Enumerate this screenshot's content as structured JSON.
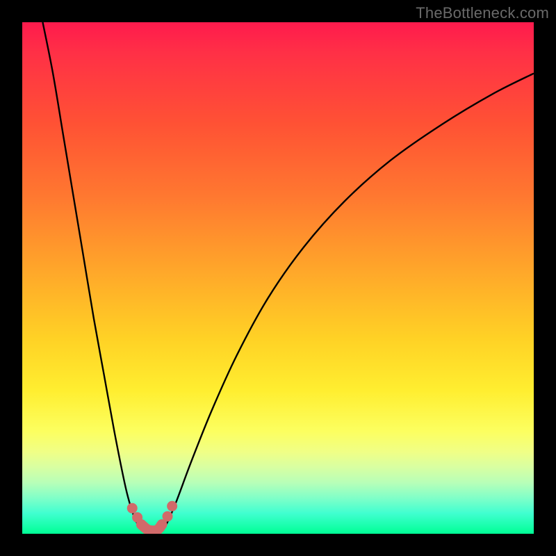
{
  "watermark": "TheBottleneck.com",
  "colors": {
    "frame_bg_top": "#ff1a4d",
    "frame_bg_bottom": "#00ff95",
    "curve_stroke": "#000000",
    "marker": "#d16a6a",
    "page_bg": "#000000",
    "watermark_text": "#6a6a6a"
  },
  "chart_data": {
    "type": "line",
    "title": "",
    "xlabel": "",
    "ylabel": "",
    "xlim": [
      0,
      100
    ],
    "ylim": [
      0,
      100
    ],
    "series": [
      {
        "name": "left-branch",
        "x": [
          4,
          6,
          8,
          10,
          12,
          14,
          16,
          18,
          20,
          21,
          22,
          23,
          24
        ],
        "y": [
          100,
          90,
          78,
          66,
          54,
          42,
          31,
          20,
          10,
          6,
          3,
          1.2,
          0.5
        ]
      },
      {
        "name": "right-branch",
        "x": [
          27,
          28,
          30,
          33,
          37,
          42,
          48,
          55,
          63,
          72,
          82,
          92,
          100
        ],
        "y": [
          0.5,
          1.5,
          6,
          14,
          24,
          35,
          46,
          56,
          65,
          73,
          80,
          86,
          90
        ]
      }
    ],
    "markers": {
      "name": "valley-dots",
      "x": [
        21.5,
        22.5,
        23.3,
        27.3,
        28.4,
        29.3
      ],
      "y": [
        5.0,
        3.2,
        1.8,
        1.8,
        3.4,
        5.4
      ]
    },
    "valley_band": {
      "x": [
        23.3,
        24.5,
        25.5,
        26.5,
        27.3
      ],
      "y": [
        1.8,
        0.8,
        0.6,
        0.8,
        1.8
      ]
    },
    "annotations": []
  }
}
